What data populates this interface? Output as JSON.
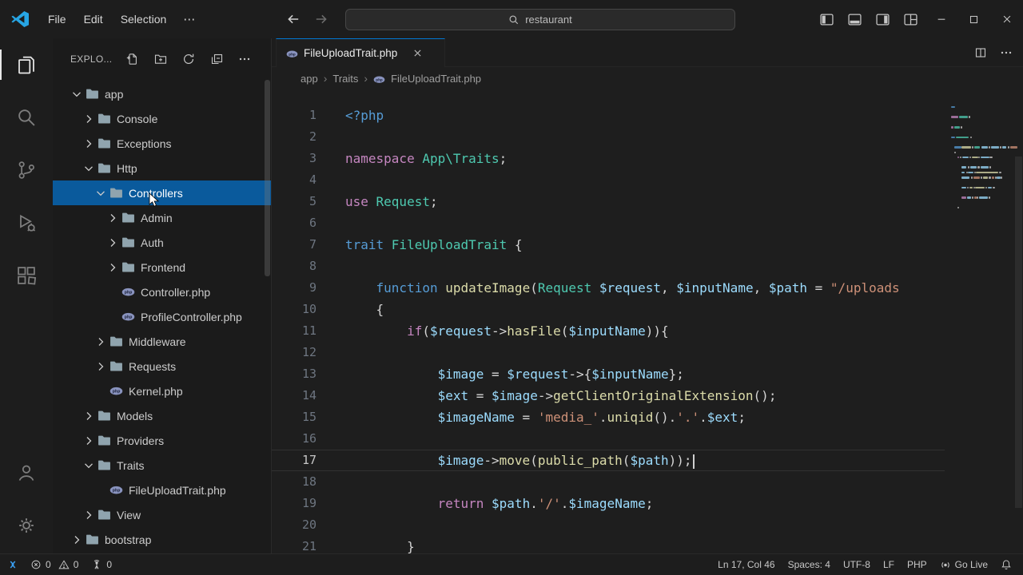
{
  "colors": {
    "accent": "#0078d4",
    "list_selection": "#0a5a9c",
    "folder_icon": "#90a4ae",
    "php_icon": "#8993be",
    "remote_icon": "#3aa0f3",
    "syntax": {
      "kw": "#c586c0",
      "st": "#569cd6",
      "ty": "#4ec9b0",
      "fn": "#dcdcaa",
      "va": "#9cdcfe",
      "sr": "#ce9178",
      "pl": "#d4d4d4"
    }
  },
  "title_bar": {
    "menus": [
      "File",
      "Edit",
      "Selection"
    ],
    "more": "⋯",
    "search_value": "restaurant"
  },
  "activity_bar": {
    "items": [
      {
        "name": "explorer",
        "active": true
      },
      {
        "name": "search"
      },
      {
        "name": "source-control"
      },
      {
        "name": "run-and-debug"
      },
      {
        "name": "extensions"
      }
    ],
    "bottom_items": [
      {
        "name": "accounts"
      },
      {
        "name": "manage"
      }
    ]
  },
  "sidebar": {
    "title": "EXPLO...",
    "actions": [
      "new-file",
      "new-folder",
      "refresh-explorer",
      "collapse-folders",
      "more-actions"
    ],
    "tree": [
      {
        "label": "app",
        "indent": 0,
        "kind": "folder",
        "state": "open"
      },
      {
        "label": "Console",
        "indent": 1,
        "kind": "folder",
        "state": "closed"
      },
      {
        "label": "Exceptions",
        "indent": 1,
        "kind": "folder",
        "state": "closed"
      },
      {
        "label": "Http",
        "indent": 1,
        "kind": "folder",
        "state": "open"
      },
      {
        "label": "Controllers",
        "indent": 2,
        "kind": "folder",
        "state": "open",
        "selected": true
      },
      {
        "label": "Admin",
        "indent": 3,
        "kind": "folder",
        "state": "closed"
      },
      {
        "label": "Auth",
        "indent": 3,
        "kind": "folder",
        "state": "closed"
      },
      {
        "label": "Frontend",
        "indent": 3,
        "kind": "folder",
        "state": "closed"
      },
      {
        "label": "Controller.php",
        "indent": 3,
        "kind": "php"
      },
      {
        "label": "ProfileController.php",
        "indent": 3,
        "kind": "php"
      },
      {
        "label": "Middleware",
        "indent": 2,
        "kind": "folder",
        "state": "closed"
      },
      {
        "label": "Requests",
        "indent": 2,
        "kind": "folder",
        "state": "closed"
      },
      {
        "label": "Kernel.php",
        "indent": 2,
        "kind": "php"
      },
      {
        "label": "Models",
        "indent": 1,
        "kind": "folder",
        "state": "closed"
      },
      {
        "label": "Providers",
        "indent": 1,
        "kind": "folder",
        "state": "closed"
      },
      {
        "label": "Traits",
        "indent": 1,
        "kind": "folder",
        "state": "open"
      },
      {
        "label": "FileUploadTrait.php",
        "indent": 2,
        "kind": "php"
      },
      {
        "label": "View",
        "indent": 1,
        "kind": "folder",
        "state": "closed"
      },
      {
        "label": "bootstrap",
        "indent": 0,
        "kind": "folder",
        "state": "closed"
      }
    ]
  },
  "editor": {
    "tab": {
      "label": "FileUploadTrait.php"
    },
    "breadcrumbs": [
      "app",
      "Traits",
      "FileUploadTrait.php"
    ],
    "current_line": 17,
    "cursor_col": 46,
    "lines": [
      {
        "n": 1,
        "tokens": [
          [
            "st",
            "<?php"
          ]
        ]
      },
      {
        "n": 2,
        "tokens": []
      },
      {
        "n": 3,
        "tokens": [
          [
            "kw",
            "namespace "
          ],
          [
            "ty",
            "App\\Traits"
          ],
          [
            "pl",
            ";"
          ]
        ]
      },
      {
        "n": 4,
        "tokens": []
      },
      {
        "n": 5,
        "tokens": [
          [
            "kw",
            "use "
          ],
          [
            "ty",
            "Request"
          ],
          [
            "pl",
            ";"
          ]
        ]
      },
      {
        "n": 6,
        "tokens": []
      },
      {
        "n": 7,
        "tokens": [
          [
            "st",
            "trait "
          ],
          [
            "ty",
            "FileUploadTrait"
          ],
          [
            "pl",
            " {"
          ]
        ]
      },
      {
        "n": 8,
        "tokens": []
      },
      {
        "n": 9,
        "tokens": [
          [
            "pl",
            "    "
          ],
          [
            "st",
            "function "
          ],
          [
            "fn",
            "updateImage"
          ],
          [
            "pl",
            "("
          ],
          [
            "ty",
            "Request"
          ],
          [
            "pl",
            " "
          ],
          [
            "va",
            "$request"
          ],
          [
            "pl",
            ", "
          ],
          [
            "va",
            "$inputName"
          ],
          [
            "pl",
            ", "
          ],
          [
            "va",
            "$path"
          ],
          [
            "pl",
            " = "
          ],
          [
            "sr",
            "\"/uploads"
          ]
        ]
      },
      {
        "n": 10,
        "tokens": [
          [
            "pl",
            "    {"
          ]
        ]
      },
      {
        "n": 11,
        "tokens": [
          [
            "pl",
            "        "
          ],
          [
            "kw",
            "if"
          ],
          [
            "pl",
            "("
          ],
          [
            "va",
            "$request"
          ],
          [
            "pl",
            "->"
          ],
          [
            "fn",
            "hasFile"
          ],
          [
            "pl",
            "("
          ],
          [
            "va",
            "$inputName"
          ],
          [
            "pl",
            ")){"
          ]
        ]
      },
      {
        "n": 12,
        "tokens": []
      },
      {
        "n": 13,
        "tokens": [
          [
            "pl",
            "            "
          ],
          [
            "va",
            "$image"
          ],
          [
            "pl",
            " = "
          ],
          [
            "va",
            "$request"
          ],
          [
            "pl",
            "->{"
          ],
          [
            "va",
            "$inputName"
          ],
          [
            "pl",
            "};"
          ]
        ]
      },
      {
        "n": 14,
        "tokens": [
          [
            "pl",
            "            "
          ],
          [
            "va",
            "$ext"
          ],
          [
            "pl",
            " = "
          ],
          [
            "va",
            "$image"
          ],
          [
            "pl",
            "->"
          ],
          [
            "fn",
            "getClientOriginalExtension"
          ],
          [
            "pl",
            "();"
          ]
        ]
      },
      {
        "n": 15,
        "tokens": [
          [
            "pl",
            "            "
          ],
          [
            "va",
            "$imageName"
          ],
          [
            "pl",
            " = "
          ],
          [
            "sr",
            "'media_'"
          ],
          [
            "pl",
            "."
          ],
          [
            "fn",
            "uniqid"
          ],
          [
            "pl",
            "()."
          ],
          [
            "sr",
            "'.'"
          ],
          [
            "pl",
            "."
          ],
          [
            "va",
            "$ext"
          ],
          [
            "pl",
            ";"
          ]
        ]
      },
      {
        "n": 16,
        "tokens": []
      },
      {
        "n": 17,
        "tokens": [
          [
            "pl",
            "            "
          ],
          [
            "va",
            "$image"
          ],
          [
            "pl",
            "->"
          ],
          [
            "fn",
            "move"
          ],
          [
            "pl",
            "("
          ],
          [
            "fn",
            "public_path"
          ],
          [
            "pl",
            "("
          ],
          [
            "va",
            "$path"
          ],
          [
            "pl",
            "));"
          ]
        ]
      },
      {
        "n": 18,
        "tokens": []
      },
      {
        "n": 19,
        "tokens": [
          [
            "pl",
            "            "
          ],
          [
            "kw",
            "return "
          ],
          [
            "va",
            "$path"
          ],
          [
            "pl",
            "."
          ],
          [
            "sr",
            "'/'"
          ],
          [
            "pl",
            "."
          ],
          [
            "va",
            "$imageName"
          ],
          [
            "pl",
            ";"
          ]
        ]
      },
      {
        "n": 20,
        "tokens": []
      },
      {
        "n": 21,
        "tokens": [
          [
            "pl",
            "        }"
          ]
        ]
      }
    ]
  },
  "status_bar": {
    "errors": "0",
    "warnings": "0",
    "ports": "0",
    "line_col": "Ln 17, Col 46",
    "indent": "Spaces: 4",
    "encoding": "UTF-8",
    "eol": "LF",
    "language": "PHP",
    "go_live": "Go Live"
  }
}
